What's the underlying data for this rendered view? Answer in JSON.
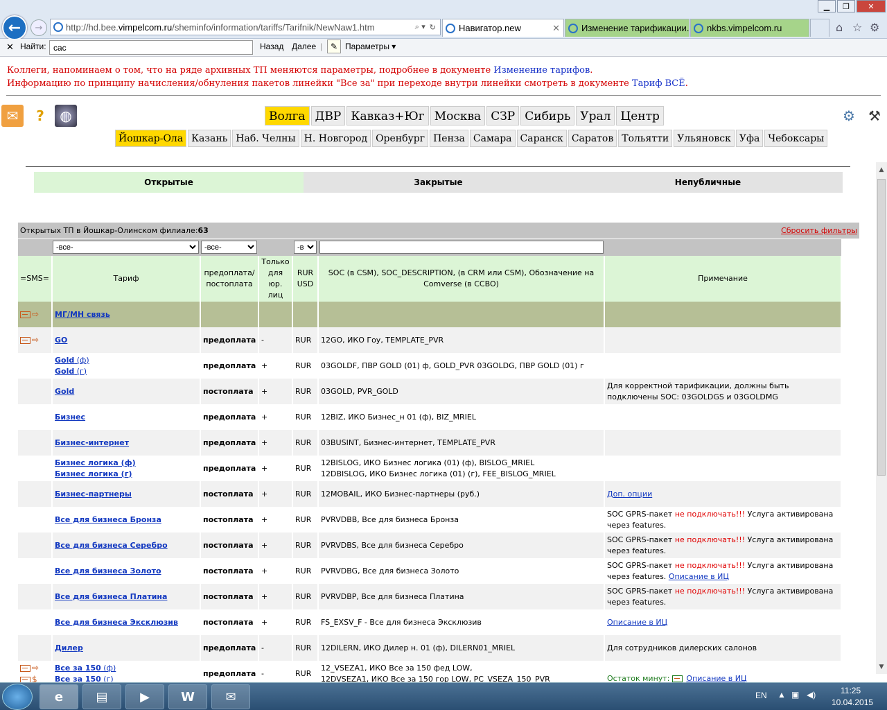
{
  "browser": {
    "url": "http://hd.bee.vimpelcom.ru/sheminfo/information/tariffs/Tarifnik/NewNaw1.htm",
    "url_prefix": "http://hd.bee.",
    "url_host": "vimpelcom.ru",
    "url_path": "/sheminfo/information/tariffs/Tarifnik/NewNaw1.htm",
    "tabs": [
      {
        "label": "Навигатор.new"
      },
      {
        "label": "Изменение тарификации..."
      },
      {
        "label": "nkbs.vimpelcom.ru"
      }
    ],
    "find_label": "Найти:",
    "find_value": "сас",
    "find_prev": "Назад",
    "find_next": "Далее",
    "find_params": "Параметры"
  },
  "notice": {
    "line1_text": "Коллеги, напоминаем о том, что на ряде архивных ТП меняются параметры, подробнее в документе ",
    "line1_link": "Изменение тарифов",
    "line2_text": "Информацию по принципу начисления/обнуления пакетов линейки \"Все за\" при переходе внутри линейки смотреть в документе ",
    "line2_link": "Тариф ВСЁ"
  },
  "regions": [
    "Волга",
    "ДВР",
    "Кавказ+Юг",
    "Москва",
    "СЗР",
    "Сибирь",
    "Урал",
    "Центр"
  ],
  "selected_region": "Волга",
  "cities": [
    "Йошкар-Ола",
    "Казань",
    "Наб. Челны",
    "Н. Новгород",
    "Оренбург",
    "Пенза",
    "Самара",
    "Саранск",
    "Саратов",
    "Тольятти",
    "Ульяновск",
    "Уфа",
    "Чебоксары"
  ],
  "selected_city": "Йошкар-Ола",
  "type_tabs": [
    "Открытые",
    "Закрытые",
    "Непубличные"
  ],
  "count_label": "Открытых ТП в Йошкар-Олинском филиале:",
  "count_value": "63",
  "reset_filters": "Сбросить фильтры",
  "filters": {
    "tariff": "-все-",
    "pay": "-все-",
    "cur": "-в"
  },
  "headers": {
    "sms": "=SMS=",
    "tariff": "Тариф",
    "pay": "предоплата/ постоплата",
    "legal": "Только для юр. лиц",
    "cur": "RUR USD",
    "soc": "SOC (в CSM), SOC_DESCRIPTION, (в CRM или CSM), Обозначение на Comverse (в CCBO)",
    "note": "Примечание"
  },
  "group_row": "МГ/МН связь",
  "rows": [
    {
      "t1": "GO",
      "pay": "предоплата",
      "legal": "-",
      "cur": "RUR",
      "soc": "12GO, ИКО Гоу, TEMPLATE_PVR",
      "note": ""
    },
    {
      "t1": "Gold",
      "t1b": " (ф)",
      "t2": "Gold",
      "t2b": " (г)",
      "pay": "предоплата",
      "legal": "+",
      "cur": "RUR",
      "soc": "03GOLDF, ПВР GOLD (01) ф, GOLD_PVR 03GOLDG, ПВР GOLD (01) г",
      "note": ""
    },
    {
      "t1": "Gold",
      "pay": "постоплата",
      "legal": "+",
      "cur": "RUR",
      "soc": "03GOLD, PVR_GOLD",
      "note": "Для корректной тарификации, должны быть подключены SOC: 03GOLDGS и 03GOLDMG"
    },
    {
      "t1": "Бизнес",
      "pay": "предоплата",
      "legal": "+",
      "cur": "RUR",
      "soc": "12BIZ, ИКО Бизнес_н 01 (ф), BIZ_MRIEL",
      "note": ""
    },
    {
      "t1": "Бизнес-интернет",
      "pay": "предоплата",
      "legal": "+",
      "cur": "RUR",
      "soc": "03BUSINT, Бизнес-интернет, TEMPLATE_PVR",
      "note": ""
    },
    {
      "t1": "Бизнес логика (ф)",
      "t2": "Бизнес логика (г)",
      "pay": "предоплата",
      "legal": "+",
      "cur": "RUR",
      "soc": "12BISLOG, ИКО Бизнес логика (01) (ф), BISLOG_MRIEL",
      "soc2": "12DBISLOG, ИКО Бизнес логика (01) (г), FEE_BISLOG_MRIEL",
      "note": ""
    },
    {
      "t1": "Бизнес-партнеры",
      "pay": "постоплата",
      "legal": "+",
      "cur": "RUR",
      "soc": "12MOBAIL, ИКО Бизнес-партнеры (руб.)",
      "note_link": "Доп. опции"
    },
    {
      "t1": "Все для бизнеса Бронза",
      "pay": "постоплата",
      "legal": "+",
      "cur": "RUR",
      "soc": "PVRVDBB, Все для бизнеса Бронза",
      "n_a": "SOC GPRS-пакет ",
      "n_red": "не подключать!!!",
      "n_b": " Услуга активирована через features."
    },
    {
      "t1": "Все для бизнеса Серебро",
      "pay": "постоплата",
      "legal": "+",
      "cur": "RUR",
      "soc": "PVRVDBS, Все для бизнеса Серебро",
      "n_a": "SOC GPRS-пакет ",
      "n_red": "не подключать!!!",
      "n_b": " Услуга активирована через features."
    },
    {
      "t1": "Все для бизнеса Золото",
      "pay": "постоплата",
      "legal": "+",
      "cur": "RUR",
      "soc": "PVRVDBG, Все для бизнеса Золото",
      "n_a": "SOC GPRS-пакет ",
      "n_red": "не подключать!!!",
      "n_b": " Услуга активирована через features. ",
      "n_link": "Описание в ИЦ"
    },
    {
      "t1": "Все для бизнеса Платина",
      "pay": "постоплата",
      "legal": "+",
      "cur": "RUR",
      "soc": "PVRVDBP, Все для бизнеса Платина",
      "n_a": "SOC GPRS-пакет ",
      "n_red": "не подключать!!!",
      "n_b": " Услуга активирована через features."
    },
    {
      "t1": "Все для бизнеса Эксклюзив",
      "pay": "постоплата",
      "legal": "+",
      "cur": "RUR",
      "soc": "FS_EXSV_F - Все для бизнеса Эксклюзив",
      "note_link": "Описание в ИЦ"
    },
    {
      "t1": "Дилер",
      "pay": "предоплата",
      "legal": "-",
      "cur": "RUR",
      "soc": "12DILERN, ИКО Дилер н. 01 (ф), DILERN01_MRIEL",
      "note": "Для сотрудников дилерских салонов"
    },
    {
      "t1": "Все за 150",
      "t1b": " (ф)",
      "t2": "Все за 150",
      "t2b": " (г)",
      "pay": "предоплата",
      "legal": "-",
      "cur": "RUR",
      "soc": "12_VSEZA1, ИКО Все за 150 фед LOW,",
      "soc2": "12DVSEZA1, ИКО Все за 150 гор LOW, PC_VSEZA_150_PVR",
      "n_green": "Остаток минут:",
      "note_link": "Описание в ИЦ"
    }
  ],
  "taskbar": {
    "lang": "EN",
    "time": "11:25",
    "date": "10.04.2015"
  }
}
